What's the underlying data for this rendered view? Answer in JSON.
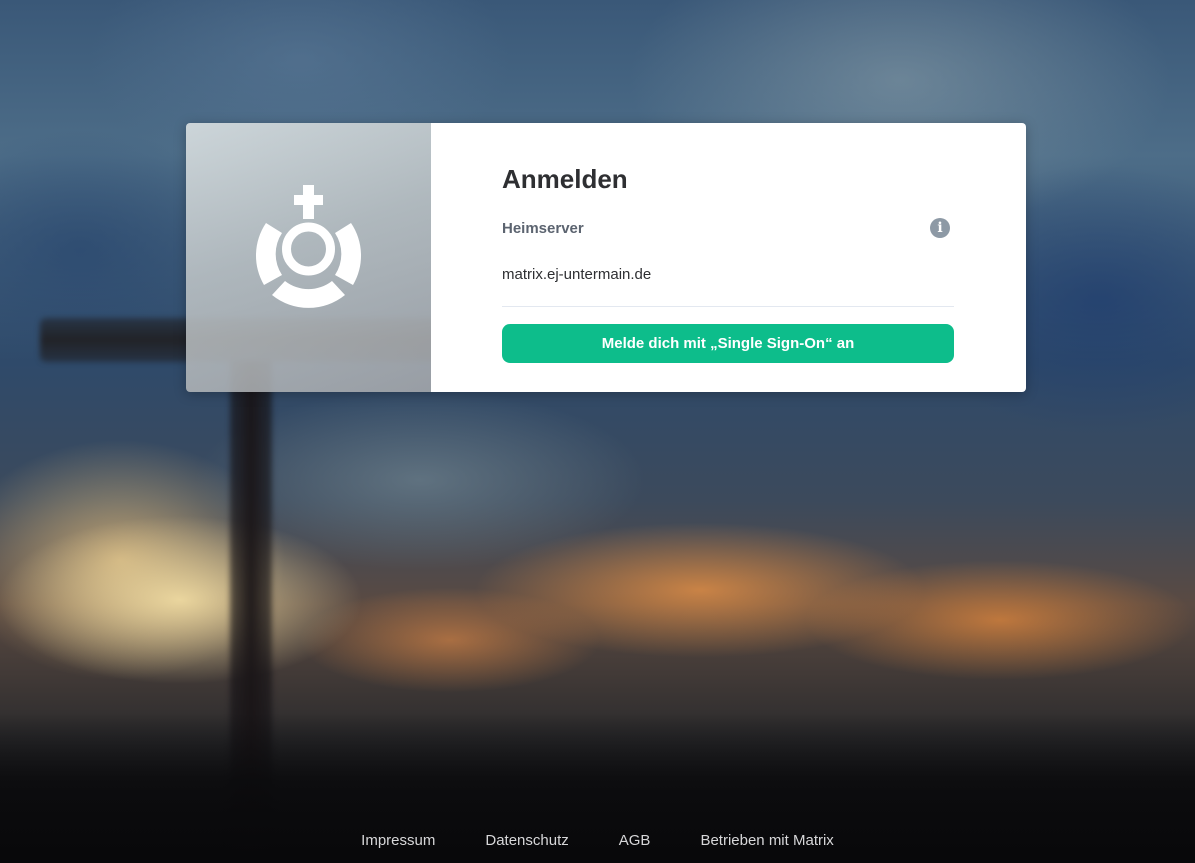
{
  "login": {
    "title": "Anmelden",
    "homeserver_label": "Heimserver",
    "homeserver_value": "matrix.ej-untermain.de",
    "info_icon": "info-icon",
    "sso_button_label": "Melde dich mit „Single Sign-On“ an",
    "accent_color": "#0dbd8b"
  },
  "footer": {
    "links": [
      {
        "label": "Impressum"
      },
      {
        "label": "Datenschutz"
      },
      {
        "label": "AGB"
      },
      {
        "label": "Betrieben mit Matrix"
      }
    ]
  },
  "branding": {
    "logo_icon": "ring-with-cross-logo"
  }
}
